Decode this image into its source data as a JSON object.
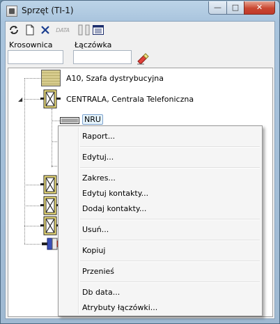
{
  "window": {
    "title": "Sprzęt (TI-1)",
    "minimize_glyph": "—",
    "maximize_glyph": "□",
    "close_glyph": "✕"
  },
  "toolbar": {
    "buttons": [
      {
        "name": "refresh-icon",
        "glyph": "⟳"
      },
      {
        "name": "new-document-icon",
        "glyph": "🗋"
      },
      {
        "name": "delete-icon",
        "glyph": "✕"
      },
      {
        "name": "data-icon",
        "text": "DATA"
      },
      {
        "name": "columns-icon",
        "glyph": ""
      },
      {
        "name": "list-view-icon",
        "glyph": ""
      }
    ]
  },
  "filters": {
    "krosownica_label": "Krosownica",
    "krosownica_value": "",
    "laczowka_label": "Łączówka",
    "laczowka_value": ""
  },
  "tree": {
    "nodes": [
      {
        "label": "A10, Szafa dystrybucyjna"
      },
      {
        "label": "CENTRALA, Centrala Telefoniczna"
      },
      {
        "label": "NRU"
      }
    ]
  },
  "context_menu": {
    "items": [
      "Raport...",
      "Edytuj...",
      "Zakres...",
      "Edytuj kontakty...",
      "Dodaj kontakty...",
      "Usuń...",
      "Kopiuj",
      "Przenieś",
      "Db data...",
      "Atrybuty łączówki..."
    ]
  },
  "colors": {
    "title_bar": "#a9c4dd",
    "close_button": "#c94731",
    "selection": "#e5f3fb",
    "delete_icon": "#1a3d8f",
    "eraser_icon": "#e0413a"
  }
}
